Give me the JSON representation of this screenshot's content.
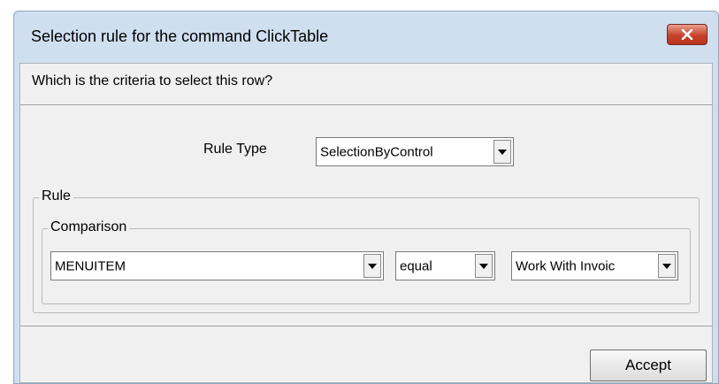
{
  "window": {
    "title": "Selection rule for the command ClickTable",
    "close_icon": "close-icon"
  },
  "question": "Which is the criteria to select this row?",
  "rule_type": {
    "label": "Rule Type",
    "value": "SelectionByControl"
  },
  "rule_group": {
    "label": "Rule",
    "comparison": {
      "label": "Comparison",
      "field": "MENUITEM",
      "operator": "equal",
      "value": "Work With Invoic"
    }
  },
  "buttons": {
    "accept": "Accept"
  },
  "colors": {
    "close_button": "#c7432b",
    "frame": "#cfdff0",
    "client": "#f0f0f0"
  }
}
